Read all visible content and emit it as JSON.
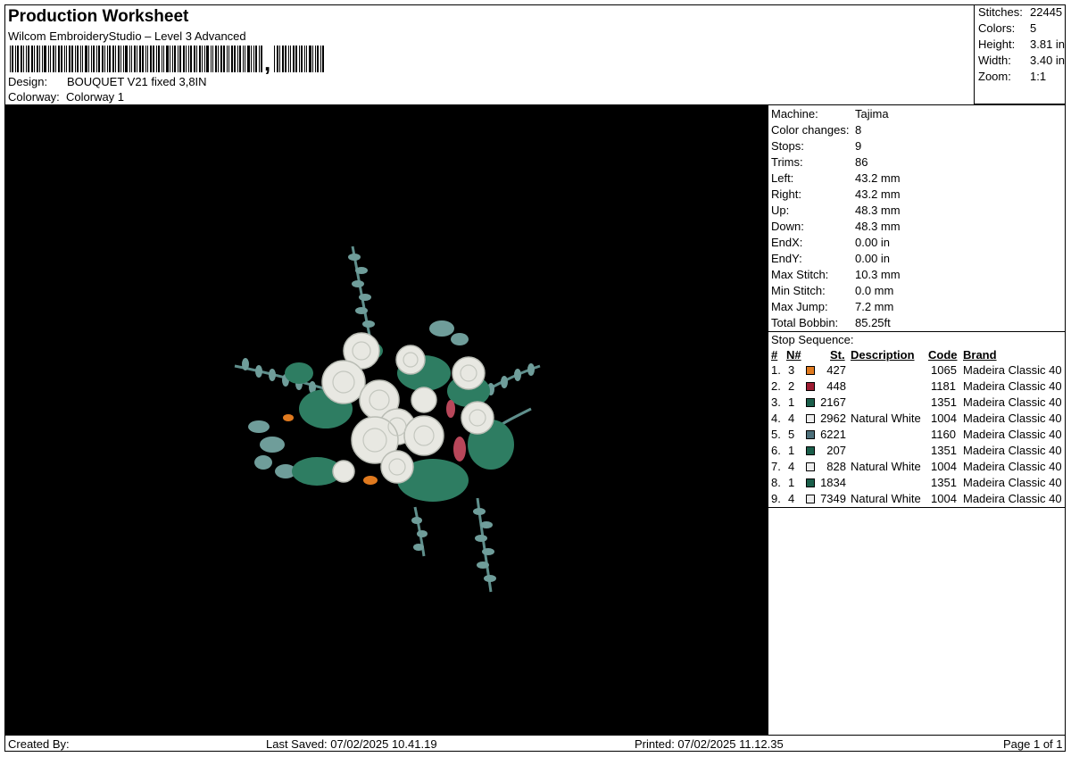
{
  "header": {
    "title": "Production Worksheet",
    "subtitle": "Wilcom EmbroideryStudio – Level 3 Advanced",
    "barcode_char": ",",
    "design_label": "Design:",
    "design_value": "BOUQUET V21 fixed 3,8IN",
    "colorway_label": "Colorway:",
    "colorway_value": "Colorway 1"
  },
  "summary": {
    "stitches_label": "Stitches:",
    "stitches_value": "22445",
    "colors_label": "Colors:",
    "colors_value": "5",
    "height_label": "Height:",
    "height_value": "3.81 in",
    "width_label": "Width:",
    "width_value": "3.40 in",
    "zoom_label": "Zoom:",
    "zoom_value": "1:1"
  },
  "info": {
    "machine_label": "Machine:",
    "machine_value": "Tajima",
    "color_changes_label": "Color changes:",
    "color_changes_value": "8",
    "stops_label": "Stops:",
    "stops_value": "9",
    "trims_label": "Trims:",
    "trims_value": "86",
    "left_label": "Left:",
    "left_value": "43.2 mm",
    "right_label": "Right:",
    "right_value": "43.2 mm",
    "up_label": "Up:",
    "up_value": "48.3 mm",
    "down_label": "Down:",
    "down_value": "48.3 mm",
    "endx_label": "EndX:",
    "endx_value": "0.00 in",
    "endy_label": "EndY:",
    "endy_value": "0.00 in",
    "max_stitch_label": "Max Stitch:",
    "max_stitch_value": "10.3 mm",
    "min_stitch_label": "Min Stitch:",
    "min_stitch_value": "0.0 mm",
    "max_jump_label": "Max Jump:",
    "max_jump_value": "7.2 mm",
    "total_bobbin_label": "Total Bobbin:",
    "total_bobbin_value": "85.25ft"
  },
  "stop_sequence": {
    "title": "Stop Sequence:",
    "headers": {
      "num": "#",
      "n": "N#",
      "st": "St.",
      "description": "Description",
      "code": "Code",
      "brand": "Brand"
    },
    "rows": [
      {
        "num": "1.",
        "n": "3",
        "color": "#e07a1f",
        "st": "427",
        "description": "",
        "code": "1065",
        "brand": "Madeira Classic 40"
      },
      {
        "num": "2.",
        "n": "2",
        "color": "#9e1b32",
        "st": "448",
        "description": "",
        "code": "1181",
        "brand": "Madeira Classic 40"
      },
      {
        "num": "3.",
        "n": "1",
        "color": "#1a5e4a",
        "st": "2167",
        "description": "",
        "code": "1351",
        "brand": "Madeira Classic 40"
      },
      {
        "num": "4.",
        "n": "4",
        "color": "#eeeeee",
        "st": "2962",
        "description": "Natural White",
        "code": "1004",
        "brand": "Madeira Classic 40"
      },
      {
        "num": "5.",
        "n": "5",
        "color": "#4d6f7a",
        "st": "6221",
        "description": "",
        "code": "1160",
        "brand": "Madeira Classic 40"
      },
      {
        "num": "6.",
        "n": "1",
        "color": "#1a5e4a",
        "st": "207",
        "description": "",
        "code": "1351",
        "brand": "Madeira Classic 40"
      },
      {
        "num": "7.",
        "n": "4",
        "color": "#eeeeee",
        "st": "828",
        "description": "Natural White",
        "code": "1004",
        "brand": "Madeira Classic 40"
      },
      {
        "num": "8.",
        "n": "1",
        "color": "#1a5e4a",
        "st": "1834",
        "description": "",
        "code": "1351",
        "brand": "Madeira Classic 40"
      },
      {
        "num": "9.",
        "n": "4",
        "color": "#eeeeee",
        "st": "7349",
        "description": "Natural White",
        "code": "1004",
        "brand": "Madeira Classic 40"
      }
    ]
  },
  "footer": {
    "created_by": "Created By:",
    "last_saved": "Last Saved: 07/02/2025 10.41.19",
    "printed": "Printed: 07/02/2025 11.12.35",
    "page": "Page 1 of 1"
  }
}
